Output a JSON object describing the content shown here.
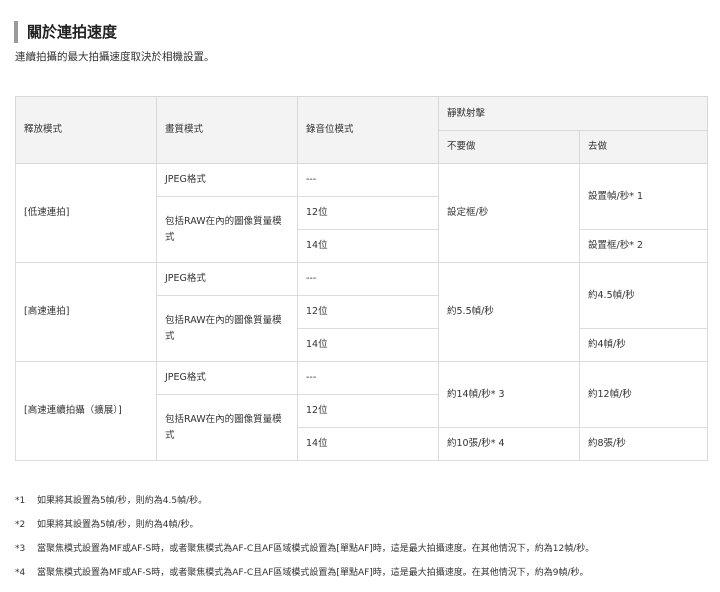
{
  "heading": "關於連拍速度",
  "intro": "連續拍攝的最大拍攝速度取決於相機設置。",
  "table": {
    "headers": {
      "release_mode": "釋放模式",
      "quality": "畫質模式",
      "bit_depth": "錄音位模式",
      "silent": "靜默射擊",
      "off": "不要做",
      "on": "去做"
    },
    "groups": [
      {
        "mode": "[低速連拍]",
        "jpeg": "JPEG格式",
        "jpeg_bits": "---",
        "raw": "包括RAW在內的圖像質量模式",
        "bits12": "12位",
        "bits14": "14位",
        "off_all": "設定框/秒",
        "on_upper": "設置幀/秒* 1",
        "on_lower": "設置框/秒* 2"
      },
      {
        "mode": "[高速連拍]",
        "jpeg": "JPEG格式",
        "jpeg_bits": "---",
        "raw": "包括RAW在內的圖像質量模式",
        "bits12": "12位",
        "bits14": "14位",
        "off_all": "約5.5幀/秒",
        "on_upper": "約4.5幀/秒",
        "on_lower": "約4幀/秒"
      },
      {
        "mode": "[高速連續拍攝（擴展）]",
        "jpeg": "JPEG格式",
        "jpeg_bits": "---",
        "raw": "包括RAW在內的圖像質量模式",
        "bits12": "12位",
        "bits14": "14位",
        "off_upper": "約14幀/秒* 3",
        "on_upper": "約12幀/秒",
        "off_lower": "約10張/秒* 4",
        "on_lower": "約8張/秒"
      }
    ]
  },
  "notes": [
    {
      "mark": "*1",
      "text": "如果將其設置為5幀/秒，則約為4.5幀/秒。"
    },
    {
      "mark": "*2",
      "text": "如果將其設置為5幀/秒，則約為4幀/秒。"
    },
    {
      "mark": "*3",
      "text": "當聚焦模式設置為MF或AF-S時，或者聚焦模式為AF-C且AF區域模式設置為[單點AF]時，這是最大拍攝速度。在其他情況下，約為12幀/秒。"
    },
    {
      "mark": "*4",
      "text": "當聚焦模式設置為MF或AF-S時，或者聚焦模式為AF-C且AF區域模式設置為[單點AF]時，這是最大拍攝速度。在其他情況下，約為9幀/秒。"
    }
  ]
}
